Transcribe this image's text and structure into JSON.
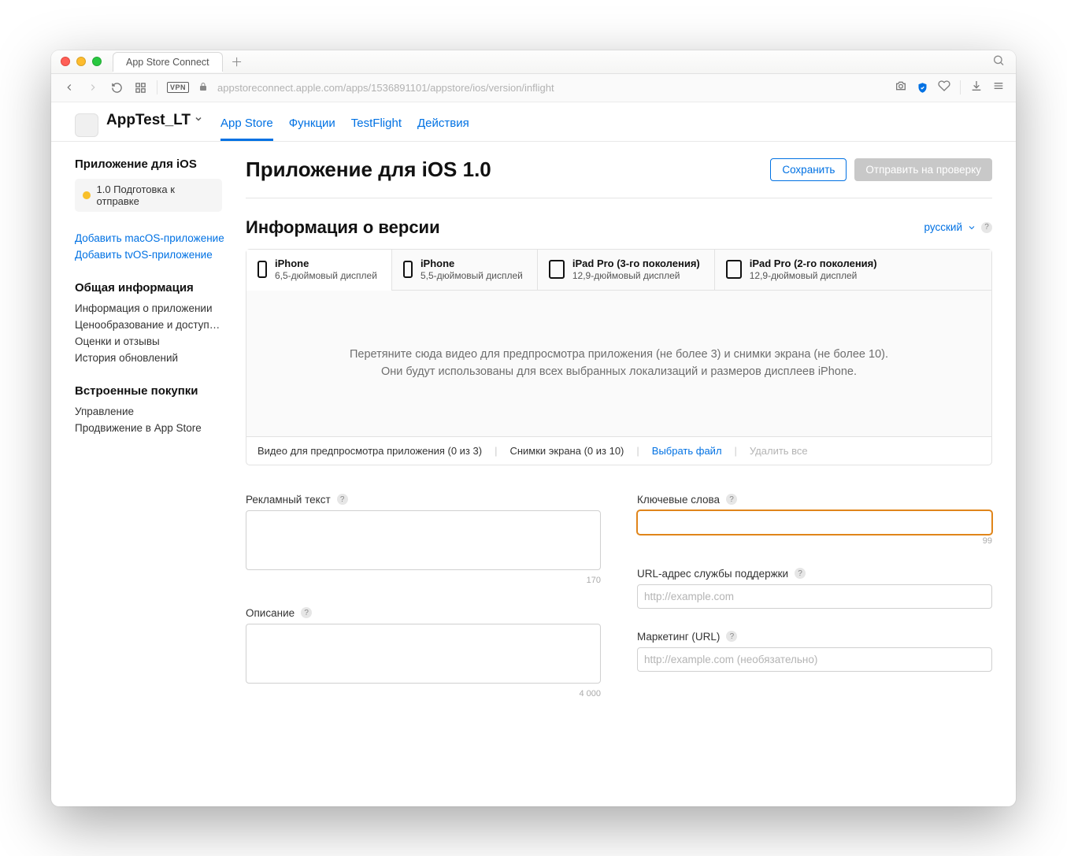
{
  "browser": {
    "tab_title": "App Store Connect",
    "url": "appstoreconnect.apple.com/apps/1536891101/appstore/ios/version/inflight"
  },
  "header": {
    "app_name": "AppTest_LT",
    "tabs": [
      "App Store",
      "Функции",
      "TestFlight",
      "Действия"
    ]
  },
  "sidebar": {
    "ios_heading": "Приложение для iOS",
    "version_status": "1.0 Подготовка к отправке",
    "add_macos": "Добавить macOS-приложение",
    "add_tvos": "Добавить tvOS-приложение",
    "general_heading": "Общая информация",
    "general_items": [
      "Информация о приложении",
      "Ценообразование и доступно…",
      "Оценки и отзывы",
      "История обновлений"
    ],
    "iap_heading": "Встроенные покупки",
    "iap_items": [
      "Управление",
      "Продвижение в App Store"
    ]
  },
  "page": {
    "title": "Приложение для iOS 1.0",
    "save_label": "Сохранить",
    "submit_label": "Отправить на проверку",
    "section_title": "Информация о версии",
    "language_label": "русский"
  },
  "devices": [
    {
      "title": "iPhone",
      "subtitle": "6,5-дюймовый дисплей",
      "kind": "phone"
    },
    {
      "title": "iPhone",
      "subtitle": "5,5-дюймовый дисплей",
      "kind": "phone"
    },
    {
      "title": "iPad Pro (3-го поколения)",
      "subtitle": "12,9-дюймовый дисплей",
      "kind": "ipad"
    },
    {
      "title": "iPad Pro (2-го поколения)",
      "subtitle": "12,9-дюймовый дисплей",
      "kind": "ipad"
    }
  ],
  "dropzone": {
    "line1": "Перетяните сюда видео для предпросмотра приложения (не более 3) и снимки экрана (не более 10).",
    "line2": "Они будут использованы для всех выбранных локализаций и размеров дисплеев iPhone.",
    "foot_preview": "Видео для предпросмотра приложения (0 из 3)",
    "foot_shots": "Снимки экрана (0 из 10)",
    "foot_choose": "Выбрать файл",
    "foot_delete": "Удалить все"
  },
  "fields": {
    "promo_label": "Рекламный текст",
    "promo_counter": "170",
    "desc_label": "Описание",
    "desc_counter": "4 000",
    "keywords_label": "Ключевые слова",
    "keywords_counter": "99",
    "support_url_label": "URL-адрес службы поддержки",
    "support_url_placeholder": "http://example.com",
    "marketing_url_label": "Маркетинг (URL)",
    "marketing_url_placeholder": "http://example.com (необязательно)"
  }
}
